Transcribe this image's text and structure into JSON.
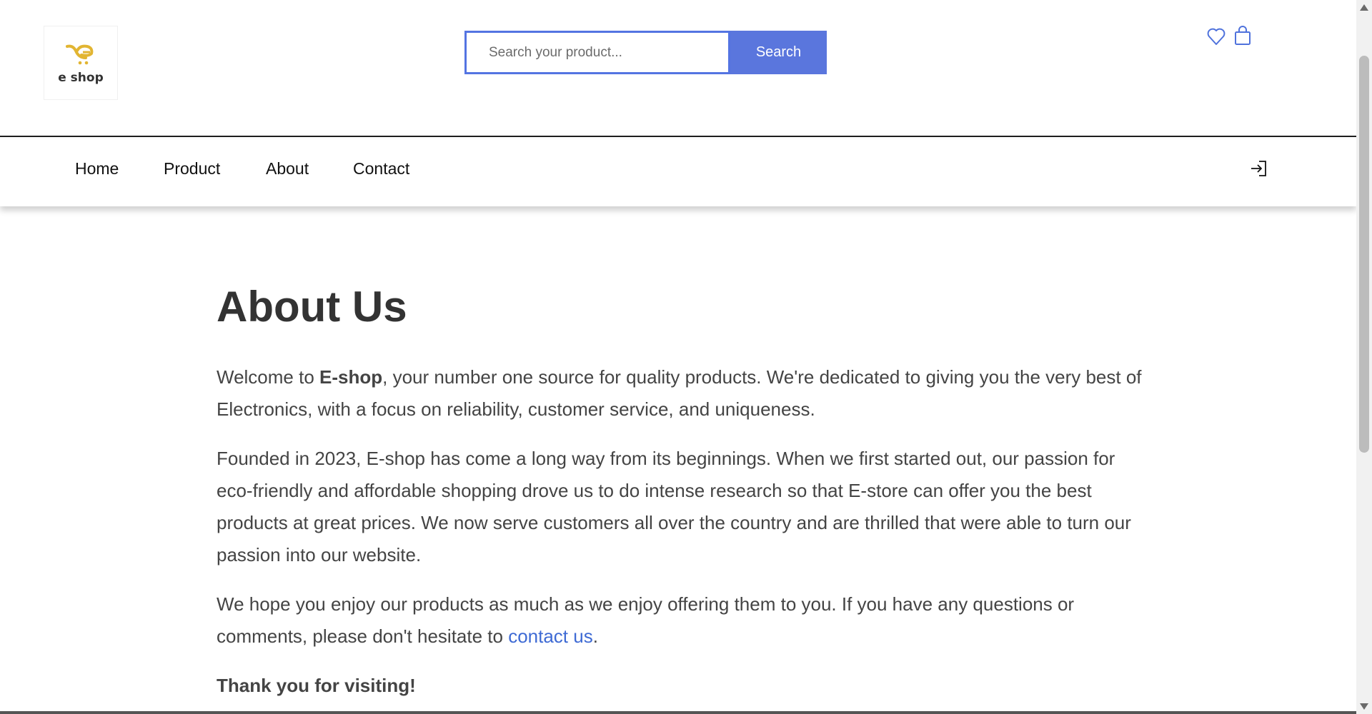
{
  "brand": {
    "logo_text": "e shop",
    "accent_color": "#e2b532"
  },
  "search": {
    "placeholder": "Search your product...",
    "button_label": "Search"
  },
  "header_icons": {
    "wishlist": "heart-icon",
    "cart": "shopping-bag-icon",
    "login": "sign-in-icon"
  },
  "nav": {
    "items": [
      {
        "label": "Home"
      },
      {
        "label": "Product"
      },
      {
        "label": "About"
      },
      {
        "label": "Contact"
      }
    ]
  },
  "about": {
    "title": "About Us",
    "p1_before_brand": "Welcome to ",
    "p1_brand": "E-shop",
    "p1_after_brand": ", your number one source for quality products. We're dedicated to giving you the very best of Electronics, with a focus on reliability, customer service, and uniqueness.",
    "p2": "Founded in 2023, E-shop has come a long way from its beginnings. When we first started out, our passion for eco-friendly and affordable shopping drove us to do intense research so that E-store can offer you the best products at great prices. We now serve customers all over the country and are thrilled that were able to turn our passion into our website.",
    "p3_before_link": "We hope you enjoy our products as much as we enjoy offering them to you. If you have any questions or comments, please don't hesitate to ",
    "p3_link": "contact us",
    "p3_after_link": ".",
    "thanks": "Thank you for visiting!"
  },
  "colors": {
    "search_blue": "#5474e2",
    "link_blue": "#3e6ad4",
    "icon_blue": "#4f72dc"
  }
}
